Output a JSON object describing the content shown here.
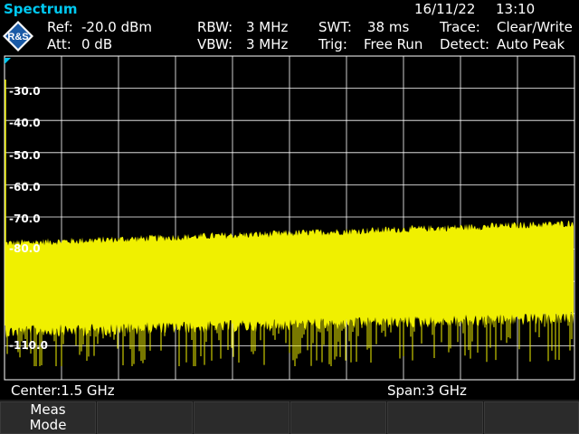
{
  "header": {
    "title": "Spectrum",
    "date": "16/11/22",
    "time": "13:10"
  },
  "logo": {
    "text": "R&S"
  },
  "settings": {
    "ref_label": "Ref:",
    "ref_value": "-20.0 dBm",
    "att_label": "Att:",
    "att_value": "0 dB",
    "rbw_label": "RBW:",
    "rbw_value": "3 MHz",
    "vbw_label": "VBW:",
    "vbw_value": "3 MHz",
    "swt_label": "SWT:",
    "swt_value": "38 ms",
    "trig_label": "Trig:",
    "trig_value": "Free Run",
    "trace_label": "Trace:",
    "trace_value": "Clear/Write",
    "detect_label": "Detect:",
    "detect_value": "Auto Peak"
  },
  "plot": {
    "y_ticks": [
      "-30.0",
      "-40.0",
      "-50.0",
      "-60.0",
      "-70.0",
      "-80.0",
      "-110.0"
    ],
    "colors": {
      "trace": "#f0f000",
      "grid": "#ffffff",
      "background": "#000000",
      "marker": "#00c8f0"
    }
  },
  "status": {
    "center": "Center:1.5 GHz",
    "span": "Span:3 GHz"
  },
  "softkeys": [
    {
      "line1": "Meas",
      "line2": "Mode"
    },
    {
      "line1": "",
      "line2": ""
    },
    {
      "line1": "",
      "line2": ""
    },
    {
      "line1": "",
      "line2": ""
    },
    {
      "line1": "",
      "line2": ""
    },
    {
      "line1": "",
      "line2": ""
    }
  ]
}
